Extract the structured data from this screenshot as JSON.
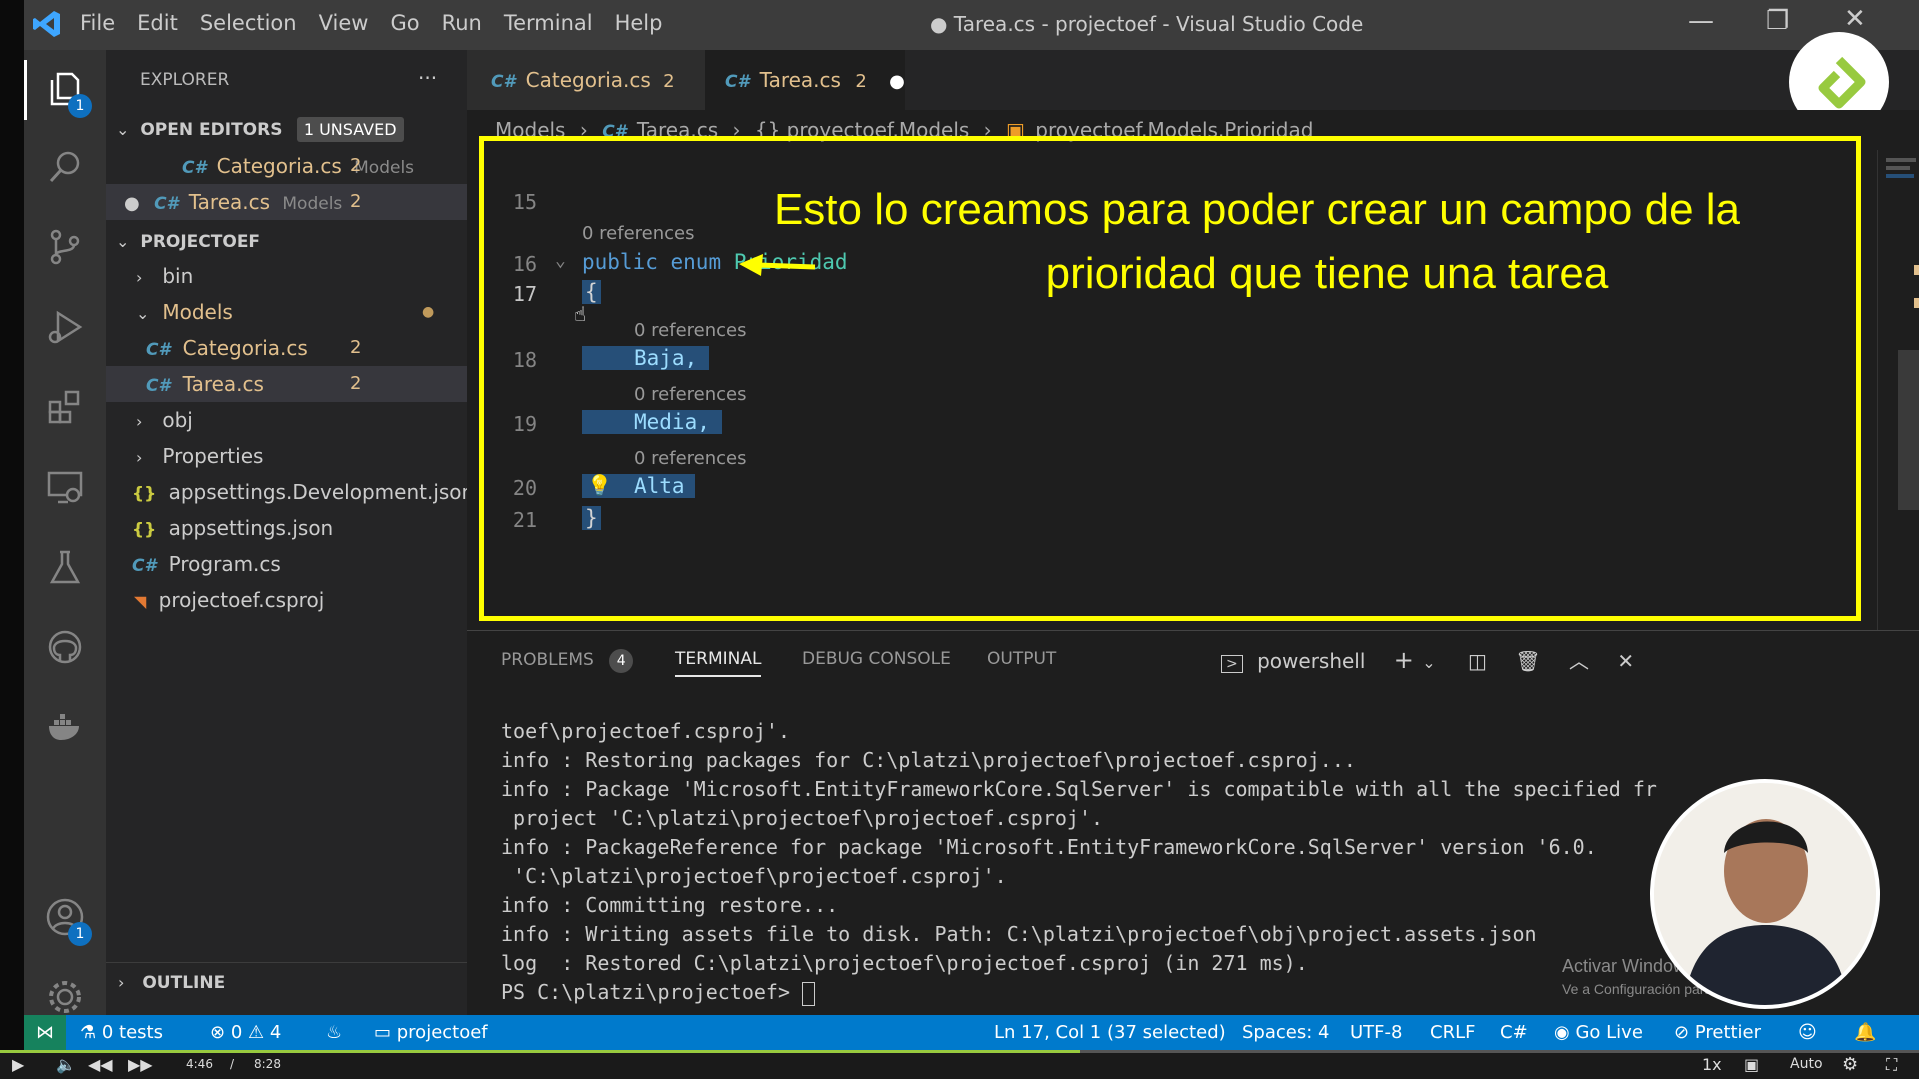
{
  "window": {
    "title": "● Tarea.cs - projectoef - Visual Studio Code"
  },
  "menu": [
    "File",
    "Edit",
    "Selection",
    "View",
    "Go",
    "Run",
    "Terminal",
    "Help"
  ],
  "activity": {
    "explorer_badge": "1",
    "accounts_badge": "1"
  },
  "sidebar": {
    "title": "EXPLORER",
    "open_editors": {
      "label": "OPEN EDITORS",
      "unsaved": "1 UNSAVED",
      "items": [
        {
          "name": "Categoria.cs",
          "folder": "Models",
          "count": "2"
        },
        {
          "name": "Tarea.cs",
          "folder": "Models",
          "count": "2"
        }
      ]
    },
    "project": {
      "label": "PROJECTOEF",
      "items": [
        {
          "label": "bin"
        },
        {
          "label": "Models"
        },
        {
          "label": "Categoria.cs",
          "count": "2"
        },
        {
          "label": "Tarea.cs",
          "count": "2"
        },
        {
          "label": "obj"
        },
        {
          "label": "Properties"
        },
        {
          "label": "appsettings.Development.json"
        },
        {
          "label": "appsettings.json"
        },
        {
          "label": "Program.cs"
        },
        {
          "label": "projectoef.csproj"
        }
      ]
    },
    "outline": "OUTLINE"
  },
  "tabs": [
    {
      "label": "Categoria.cs",
      "count": "2"
    },
    {
      "label": "Tarea.cs",
      "count": "2"
    }
  ],
  "breadcrumb": [
    "Models",
    "Tarea.cs",
    "{} proyectoef.Models",
    "proyectoef.Models.Prioridad"
  ],
  "editor": {
    "refs": "0 references",
    "lines": [
      {
        "n": "15"
      },
      {
        "n": "16",
        "text": "public enum Prioridad"
      },
      {
        "n": "17",
        "text": "{"
      },
      {
        "n": "18",
        "text": "Baja,"
      },
      {
        "n": "19",
        "text": "Media,"
      },
      {
        "n": "20",
        "text": "Alta"
      },
      {
        "n": "21",
        "text": "}"
      }
    ],
    "kw1": "public",
    "kw2": "enum",
    "type": "Prioridad",
    "annotation_line1": "Esto lo creamos para poder crear un campo de la",
    "annotation_line2": "prioridad que tiene una tarea"
  },
  "panel": {
    "tabs": {
      "problems": "PROBLEMS",
      "problems_count": "4",
      "terminal": "TERMINAL",
      "debug": "DEBUG CONSOLE",
      "output": "OUTPUT"
    },
    "shell": "powershell",
    "terminal_lines": [
      "toef\\projectoef.csproj'.",
      "info : Restoring packages for C:\\platzi\\projectoef\\projectoef.csproj...",
      "info : Package 'Microsoft.EntityFrameworkCore.SqlServer' is compatible with all the specified fr",
      " project 'C:\\platzi\\projectoef\\projectoef.csproj'.",
      "info : PackageReference for package 'Microsoft.EntityFrameworkCore.SqlServer' version '6.0.",
      " 'C:\\platzi\\projectoef\\projectoef.csproj'.",
      "info : Committing restore...",
      "info : Writing assets file to disk. Path: C:\\platzi\\projectoef\\obj\\project.assets.json",
      "log  : Restored C:\\platzi\\projectoef\\projectoef.csproj (in 271 ms).",
      "PS C:\\platzi\\projectoef> "
    ],
    "watermark1": "Activar Windows",
    "watermark2": "Ve a Configuración para activar Windows."
  },
  "status": {
    "tests": "0 tests",
    "errors": "0",
    "warnings": "4",
    "project": "projectoef",
    "position": "Ln 17, Col 1 (37 selected)",
    "spaces": "Spaces: 4",
    "encoding": "UTF-8",
    "eol": "CRLF",
    "lang": "C#",
    "golive": "Go Live",
    "prettier": "Prettier"
  },
  "player": {
    "current": "4:46",
    "sep": "/",
    "total": "8:28",
    "speed": "1x",
    "quality": "Auto"
  },
  "colors": {
    "accent": "#007acc",
    "annotation": "#ffff00",
    "activity": "#333333",
    "sidebar": "#252526",
    "editor": "#1e1e1e"
  }
}
